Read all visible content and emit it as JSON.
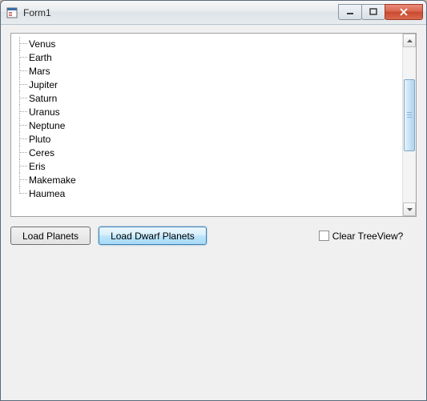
{
  "window": {
    "title": "Form1"
  },
  "treeview": {
    "items": [
      {
        "label": "Venus"
      },
      {
        "label": "Earth"
      },
      {
        "label": "Mars"
      },
      {
        "label": "Jupiter"
      },
      {
        "label": "Saturn"
      },
      {
        "label": "Uranus"
      },
      {
        "label": "Neptune"
      },
      {
        "label": "Pluto"
      },
      {
        "label": "Ceres"
      },
      {
        "label": "Eris"
      },
      {
        "label": "Makemake"
      },
      {
        "label": "Haumea"
      }
    ]
  },
  "buttons": {
    "load_planets": "Load Planets",
    "load_dwarf_planets": "Load Dwarf Planets"
  },
  "checkbox": {
    "clear_treeview_label": "Clear TreeView?",
    "checked": false
  }
}
